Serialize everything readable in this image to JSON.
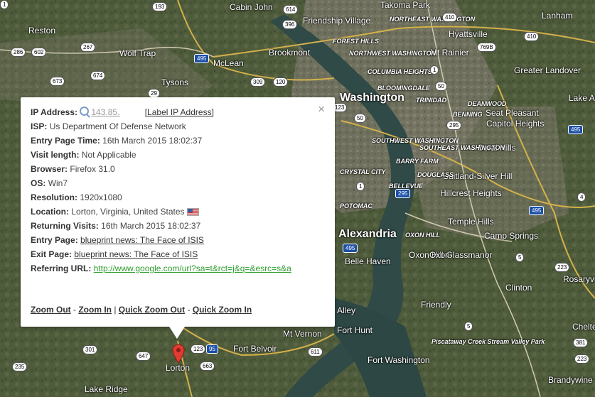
{
  "map": {
    "place_labels": [
      {
        "text": "Takoma Park",
        "kind": "mid"
      },
      {
        "text": "Lanham",
        "kind": "mid"
      },
      {
        "text": "Cabin John",
        "kind": "mid"
      },
      {
        "text": "Friendship Village",
        "kind": "mid"
      },
      {
        "text": "Reston",
        "kind": "mid"
      },
      {
        "text": "Wolf Trap",
        "kind": "mid"
      },
      {
        "text": "McLean",
        "kind": "mid"
      },
      {
        "text": "Brookmont",
        "kind": "mid"
      },
      {
        "text": "Hyattsville",
        "kind": "mid"
      },
      {
        "text": "Mt Rainier",
        "kind": "mid"
      },
      {
        "text": "Greater Landover",
        "kind": "mid"
      },
      {
        "text": "Tysons",
        "kind": "mid"
      },
      {
        "text": "Washington",
        "kind": "big"
      },
      {
        "text": "Lake Arbor",
        "kind": "mid"
      },
      {
        "text": "Seat Pleasant",
        "kind": "mid"
      },
      {
        "text": "Capitol Heights",
        "kind": "mid"
      },
      {
        "text": "Coral Hills",
        "kind": "mid"
      },
      {
        "text": "Suitland-Silver Hill",
        "kind": "mid"
      },
      {
        "text": "Hillcrest Heights",
        "kind": "mid"
      },
      {
        "text": "Temple Hills",
        "kind": "mid"
      },
      {
        "text": "Alexandria",
        "kind": "big"
      },
      {
        "text": "Camp Springs",
        "kind": "mid"
      },
      {
        "text": "Oxon Hill-Glassmanor",
        "kind": "mid"
      },
      {
        "text": "Clinton",
        "kind": "mid"
      },
      {
        "text": "Rosaryville",
        "kind": "mid"
      },
      {
        "text": "Friendly",
        "kind": "mid"
      },
      {
        "text": "Fort Hunt",
        "kind": "mid"
      },
      {
        "text": "Mt Vernon",
        "kind": "mid"
      },
      {
        "text": "Fort Belvoir",
        "kind": "mid"
      },
      {
        "text": "Fort Washington",
        "kind": "mid"
      },
      {
        "text": "Piscataway Creek Stream Valley Park",
        "kind": "small"
      },
      {
        "text": "Lorton",
        "kind": "mid"
      },
      {
        "text": "Lake Ridge",
        "kind": "mid"
      },
      {
        "text": "Brandywine",
        "kind": "mid"
      },
      {
        "text": "Chelte",
        "kind": "mid"
      },
      {
        "text": "Alley",
        "kind": "mid"
      },
      {
        "text": "Belle Haven",
        "kind": "mid"
      },
      {
        "text": "NORTHEAST WASHINGTON",
        "kind": "small"
      },
      {
        "text": "FOREST HILLS",
        "kind": "small"
      },
      {
        "text": "NORTHWEST WASHINGTON",
        "kind": "small"
      },
      {
        "text": "COLUMBIA HEIGHTS",
        "kind": "small"
      },
      {
        "text": "BLOOMINGDALE",
        "kind": "small"
      },
      {
        "text": "SOUTHWEST WASHINGTON",
        "kind": "small"
      },
      {
        "text": "SOUTHEAST WASHINGTON",
        "kind": "small"
      },
      {
        "text": "BARRY FARM",
        "kind": "small"
      },
      {
        "text": "CRYSTAL CITY",
        "kind": "small"
      },
      {
        "text": "DOUGLASS",
        "kind": "small"
      },
      {
        "text": "BELLEVUE",
        "kind": "small"
      },
      {
        "text": "POTOMAC",
        "kind": "small"
      },
      {
        "text": "OXON HILL",
        "kind": "small"
      },
      {
        "text": "DEANWOOD",
        "kind": "small"
      },
      {
        "text": "BENNING",
        "kind": "small"
      },
      {
        "text": "TRINIDAD",
        "kind": "small"
      },
      {
        "text": "Oxon",
        "kind": "mid"
      }
    ],
    "route_shields": [
      {
        "text": "193",
        "kind": "state"
      },
      {
        "text": "614",
        "kind": "state"
      },
      {
        "text": "396",
        "kind": "state"
      },
      {
        "text": "410",
        "kind": "state"
      },
      {
        "text": "410",
        "kind": "state"
      },
      {
        "text": "286",
        "kind": "state"
      },
      {
        "text": "602",
        "kind": "state"
      },
      {
        "text": "267",
        "kind": "state"
      },
      {
        "text": "495",
        "kind": "interstate"
      },
      {
        "text": "769B",
        "kind": "state"
      },
      {
        "text": "1",
        "kind": "state"
      },
      {
        "text": "674",
        "kind": "state"
      },
      {
        "text": "673",
        "kind": "state"
      },
      {
        "text": "309",
        "kor": "state"
      },
      {
        "text": "120",
        "kind": "state"
      },
      {
        "text": "29",
        "kind": "state"
      },
      {
        "text": "123",
        "kind": "state"
      },
      {
        "text": "50",
        "kind": "state"
      },
      {
        "text": "50",
        "kind": "state"
      },
      {
        "text": "295",
        "kind": "state"
      },
      {
        "text": "495",
        "kind": "interstate"
      },
      {
        "text": "1",
        "kind": "state"
      },
      {
        "text": "295",
        "kind": "interstate"
      },
      {
        "text": "495",
        "kind": "interstate"
      },
      {
        "text": "495",
        "kind": "interstate"
      },
      {
        "text": "4",
        "kind": "state"
      },
      {
        "text": "5",
        "kind": "state"
      },
      {
        "text": "223",
        "kind": "state"
      },
      {
        "text": "5",
        "kind": "state"
      },
      {
        "text": "223",
        "kind": "state"
      },
      {
        "text": "381",
        "kind": "state"
      },
      {
        "text": "301",
        "kind": "state"
      },
      {
        "text": "647",
        "kind": "state"
      },
      {
        "text": "123",
        "kind": "state"
      },
      {
        "text": "95",
        "kind": "interstate"
      },
      {
        "text": "611",
        "kind": "state"
      },
      {
        "text": "235",
        "kind": "state"
      },
      {
        "text": "663",
        "kind": "state"
      },
      {
        "text": "1",
        "kind": "state"
      }
    ],
    "pin_label": "Lorton"
  },
  "popup": {
    "close_label": "×",
    "rows": {
      "ip": {
        "label": "IP Address:",
        "value": "143.85.",
        "action": "[Label IP Address]"
      },
      "isp": {
        "label": "ISP:",
        "value": "Us Department Of Defense Network"
      },
      "entry_time": {
        "label": "Entry Page Time:",
        "value": "16th March 2015 18:02:37"
      },
      "visit_length": {
        "label": "Visit length:",
        "value": "Not Applicable"
      },
      "browser": {
        "label": "Browser:",
        "value": "Firefox 31.0"
      },
      "os": {
        "label": "OS:",
        "value": "Win7"
      },
      "resolution": {
        "label": "Resolution:",
        "value": "1920x1080"
      },
      "location": {
        "label": "Location:",
        "value": "Lorton, Virginia, United States",
        "flag_icon": "us-flag-icon"
      },
      "returning": {
        "label": "Returning Visits:",
        "value": "16th March 2015 18:02:37"
      },
      "entry_page": {
        "label": "Entry Page:",
        "value": "blueprint news: The Face of ISIS"
      },
      "exit_page": {
        "label": "Exit Page:",
        "value": "blueprint news: The Face of ISIS"
      },
      "referring": {
        "label": "Referring URL:",
        "value": "http://www.google.com/url?sa=t&rct=j&q=&esrc=s&a"
      }
    },
    "zoom": {
      "zoom_out": "Zoom Out",
      "sep1": " - ",
      "zoom_in": "Zoom In",
      "sep2": " | ",
      "quick_zoom_out": "Quick Zoom Out",
      "sep3": " - ",
      "quick_zoom_in": "Quick Zoom In"
    }
  },
  "colors": {
    "link_green": "#2e9c2e",
    "pin_red": "#e03c31"
  }
}
